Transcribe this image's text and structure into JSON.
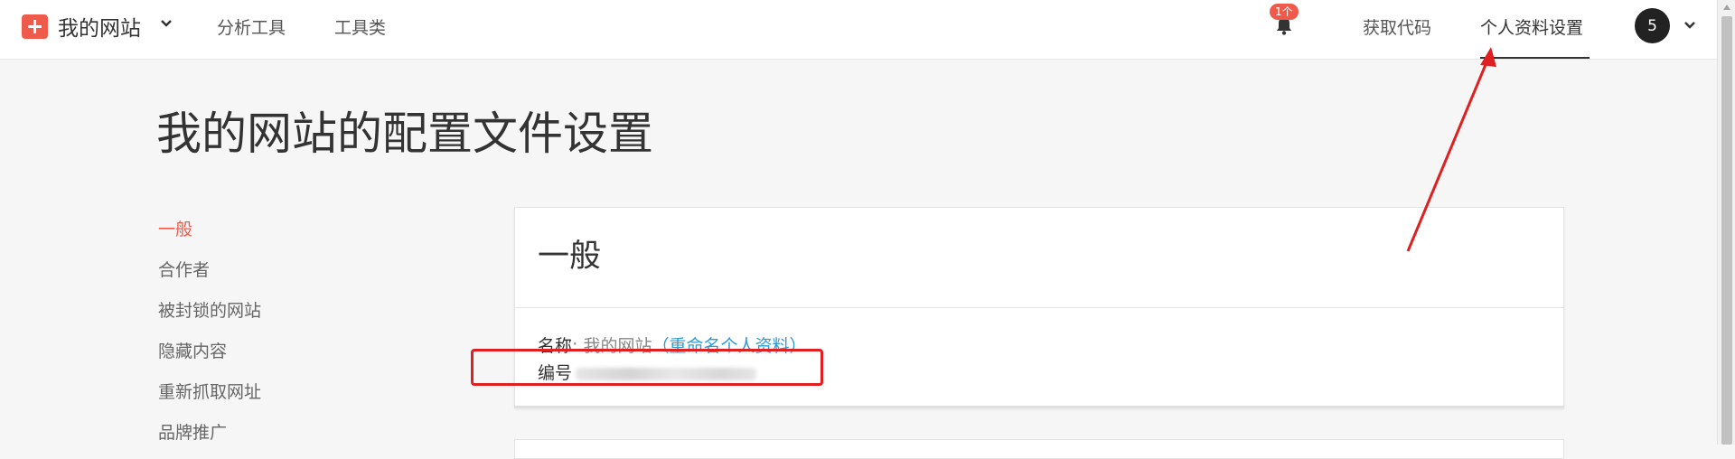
{
  "header": {
    "site_name": "我的网站",
    "nav": [
      "分析工具",
      "工具类"
    ],
    "notification_badge": "1个",
    "get_code": "获取代码",
    "profile_settings": "个人资料设置",
    "avatar_text": "5"
  },
  "page": {
    "title": "我的网站的配置文件设置"
  },
  "sidebar": {
    "items": [
      {
        "label": "一般",
        "active": true
      },
      {
        "label": "合作者",
        "active": false
      },
      {
        "label": "被封锁的网站",
        "active": false
      },
      {
        "label": "隐藏内容",
        "active": false
      },
      {
        "label": "重新抓取网址",
        "active": false
      },
      {
        "label": "品牌推广",
        "active": false
      }
    ]
  },
  "general_card": {
    "title": "一般",
    "name_label": "名称",
    "name_value": "我的网站",
    "rename_link": "（重命名个人资料）",
    "id_label": "编号"
  },
  "colors": {
    "accent": "#ef5a4a",
    "link": "#2e9bd6",
    "annotation": "#e02020"
  },
  "icons": [
    "plus-logo-icon",
    "chevron-down-icon",
    "bell-icon",
    "scroll-up-icon",
    "scroll-down-icon"
  ]
}
